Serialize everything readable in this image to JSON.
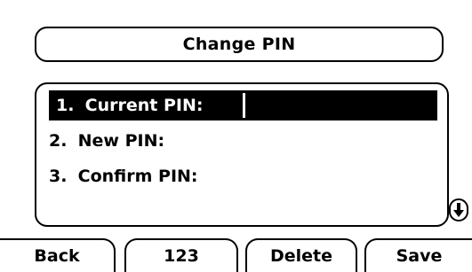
{
  "header": {
    "title": "Change PIN"
  },
  "list": {
    "items": [
      {
        "number": "1.",
        "label": "Current PIN:"
      },
      {
        "number": "2.",
        "label": "New PIN:"
      },
      {
        "number": "3.",
        "label": "Confirm PIN:"
      }
    ],
    "selected_index": 0
  },
  "scroll": {
    "icon": "scroll-down-icon"
  },
  "softkeys": {
    "back": "Back",
    "mode": "123",
    "delete": "Delete",
    "save": "Save"
  },
  "colors": {
    "foreground": "#000000",
    "background": "#ffffff"
  }
}
